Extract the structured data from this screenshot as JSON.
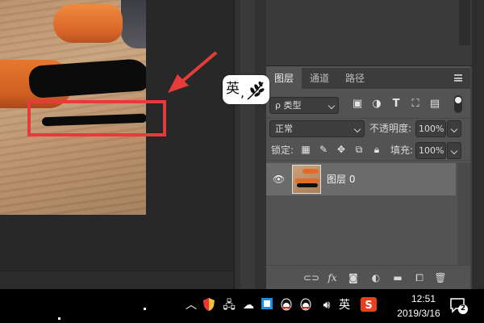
{
  "ime": {
    "char": "英",
    "punct": ","
  },
  "layers_panel": {
    "tabs": [
      {
        "label": "图层"
      },
      {
        "label": "通道"
      },
      {
        "label": "路径"
      }
    ],
    "filter": {
      "kind_label": "ρ 类型"
    },
    "blend_mode": "正常",
    "opacity_label": "不透明度:",
    "opacity_value": "100%",
    "lock_label": "锁定:",
    "fill_label": "填充:",
    "fill_value": "100%",
    "layers": [
      {
        "name": "图层 0",
        "visible": true,
        "selected": true
      }
    ]
  },
  "taskbar": {
    "ime_indicator": "英",
    "time": "12:51",
    "date": "2019/3/16",
    "notification_count": "2"
  },
  "colors": {
    "highlight_box": "#e63b3b",
    "panel_bg": "#535353",
    "taskbar_bg": "#000000"
  }
}
